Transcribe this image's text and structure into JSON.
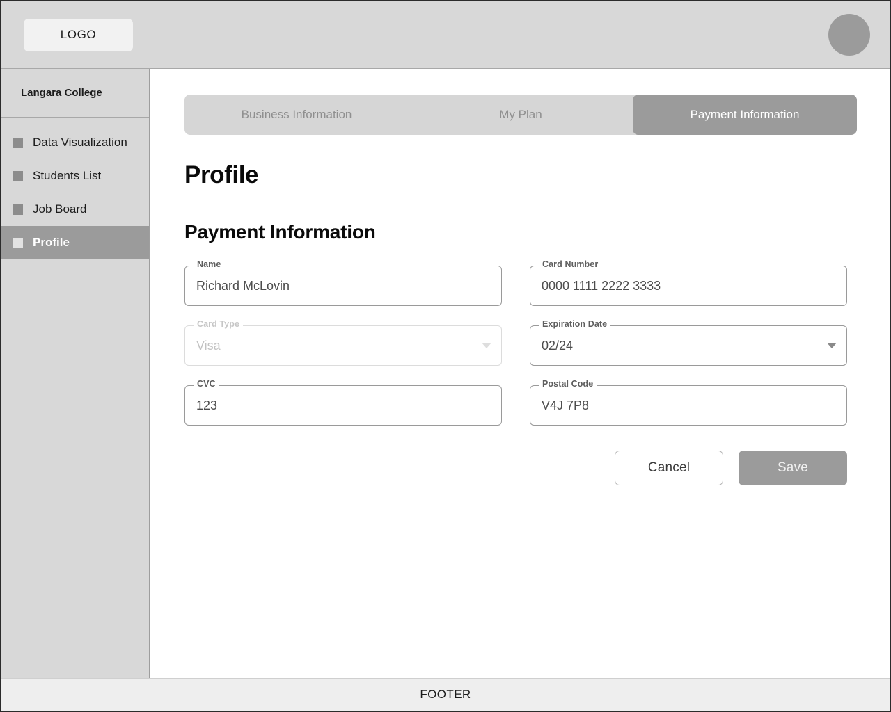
{
  "header": {
    "logo_label": "LOGO",
    "avatar_icon": "user-avatar-icon"
  },
  "sidebar": {
    "org_name": "Langara College",
    "items": [
      {
        "label": "Data Visualization",
        "icon": "square-icon",
        "active": false
      },
      {
        "label": "Students List",
        "icon": "square-icon",
        "active": false
      },
      {
        "label": "Job Board",
        "icon": "square-icon",
        "active": false
      },
      {
        "label": "Profile",
        "icon": "square-icon",
        "active": true
      }
    ]
  },
  "main": {
    "tabs": [
      {
        "label": "Business Information",
        "active": false
      },
      {
        "label": "My Plan",
        "active": false
      },
      {
        "label": "Payment Information",
        "active": true
      }
    ],
    "page_title": "Profile",
    "section_title": "Payment Information",
    "fields": {
      "name": {
        "label": "Name",
        "value": "Richard McLovin",
        "type": "text",
        "disabled": false
      },
      "card_number": {
        "label": "Card Number",
        "value": "0000 1111 2222 3333",
        "type": "text",
        "disabled": false
      },
      "card_type": {
        "label": "Card Type",
        "value": "Visa",
        "type": "select",
        "disabled": true
      },
      "expiration_date": {
        "label": "Expiration Date",
        "value": "02/24",
        "type": "select",
        "disabled": false
      },
      "cvc": {
        "label": "CVC",
        "value": "123",
        "type": "text",
        "disabled": false
      },
      "postal_code": {
        "label": "Postal Code",
        "value": "V4J 7P8",
        "type": "text",
        "disabled": false
      }
    },
    "buttons": {
      "cancel_label": "Cancel",
      "save_label": "Save"
    }
  },
  "footer": {
    "label": "FOOTER"
  },
  "colors": {
    "chrome_gray": "#d8d8d8",
    "accent_gray": "#9b9b9b",
    "footer_gray": "#eeeeee",
    "border_gray": "#9a9a9a",
    "page_border": "#2b2b2b"
  }
}
